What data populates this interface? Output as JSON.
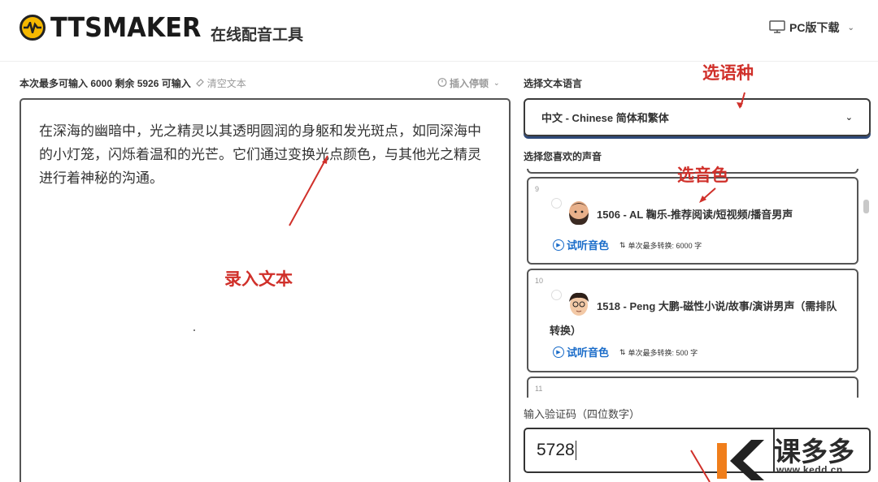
{
  "header": {
    "logo_text": "TTSMAKER",
    "tagline": "在线配音工具",
    "pc_download": "PC版下载"
  },
  "editor": {
    "limit_info": "本次最多可输入 6000 剩余 5926 可输入",
    "clear_text": "清空文本",
    "insert_pause": "插入停顿",
    "content": "在深海的幽暗中，光之精灵以其透明圆润的身躯和发光斑点，如同深海中的小灯笼，闪烁着温和的光芒。它们通过变换光点颜色，与其他光之精灵进行着神秘的沟通。"
  },
  "language": {
    "label": "选择文本语言",
    "selected": "中文 - Chinese 简体和繁体"
  },
  "voices": {
    "label": "选择您喜欢的声音",
    "items": [
      {
        "num": "9",
        "name": "1506 - AL 鞠乐-推荐阅读/短视频/播音男声",
        "listen": "试听音色",
        "max": "单次最多转换: 6000 字"
      },
      {
        "num": "10",
        "name_line1": "1518 - Peng 大鹏-磁性小说/故事/演讲男声（需排队",
        "name_line2": "转换）",
        "listen": "试听音色",
        "max": "单次最多转换: 500 字"
      },
      {
        "num": "11"
      }
    ]
  },
  "captcha": {
    "label": "输入验证码（四位数字）",
    "value": "5728"
  },
  "annotations": {
    "language": "选语种",
    "voice": "选音色",
    "text": "录入文本",
    "color": "#d0302a"
  },
  "watermark": {
    "text": "课多多",
    "url": "www.kedd.cn"
  }
}
